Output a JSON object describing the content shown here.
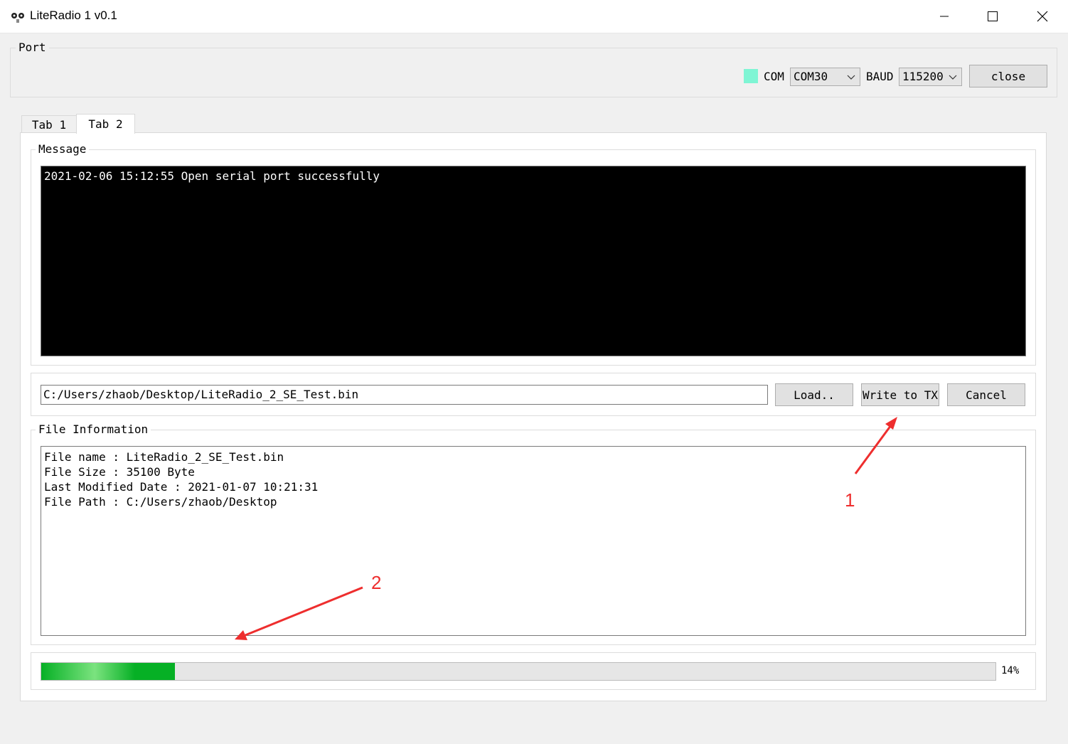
{
  "window": {
    "title": "LiteRadio 1 v0.1",
    "icons": {
      "app": "robot-face-icon",
      "minimize": "minimize-icon",
      "maximize": "maximize-icon",
      "close": "close-icon"
    }
  },
  "port": {
    "legend": "Port",
    "status_color": "#7ff5d4",
    "com_label": "COM",
    "com_value": "COM30",
    "baud_label": "BAUD",
    "baud_value": "115200",
    "close_button": "close"
  },
  "tabs": [
    {
      "label": "Tab 1",
      "active": false
    },
    {
      "label": "Tab 2",
      "active": true
    }
  ],
  "message": {
    "legend": "Message",
    "log": "2021-02-06 15:12:55 Open serial port successfully"
  },
  "file_select": {
    "path": "C:/Users/zhaob/Desktop/LiteRadio_2_SE_Test.bin",
    "load_button": "Load..",
    "write_button": "Write to TX",
    "cancel_button": "Cancel"
  },
  "file_info": {
    "legend": "File Information",
    "lines": [
      "File name : LiteRadio_2_SE_Test.bin",
      "File Size : 35100 Byte",
      "Last Modified Date : 2021-01-07 10:21:31",
      "File Path : C:/Users/zhaob/Desktop"
    ]
  },
  "progress": {
    "value": 0.14,
    "label": "14%"
  },
  "annotations": {
    "one": "1",
    "two": "2",
    "color": "#ee2e2e"
  }
}
